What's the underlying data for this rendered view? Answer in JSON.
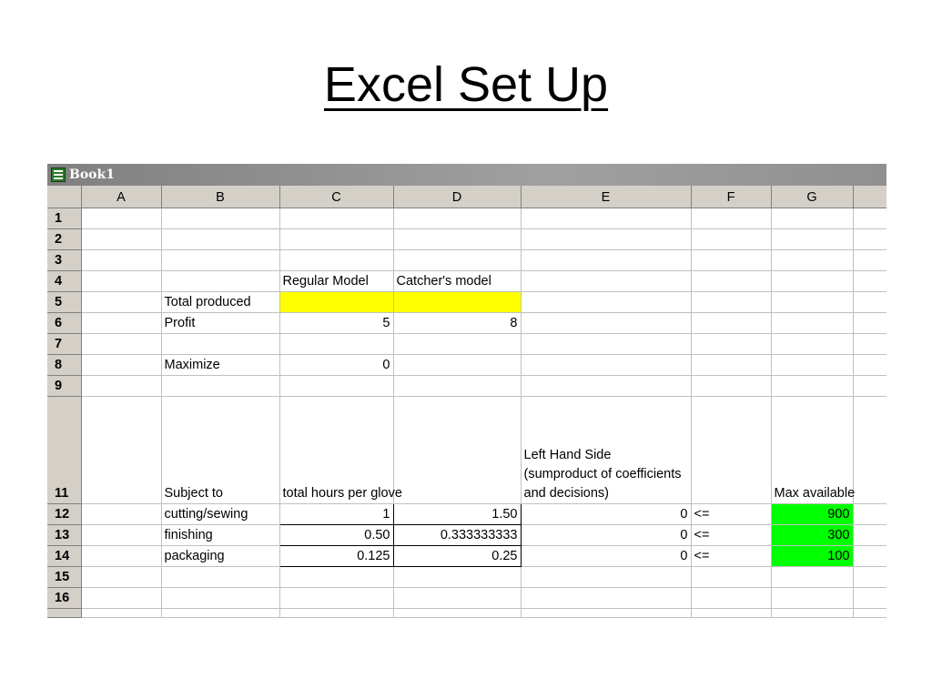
{
  "slide": {
    "title": "Excel Set Up"
  },
  "window": {
    "title": "Book1",
    "icon": "excel-icon"
  },
  "columns": [
    "",
    "A",
    "B",
    "C",
    "D",
    "E",
    "F",
    "G",
    ""
  ],
  "row_numbers": [
    "1",
    "2",
    "3",
    "4",
    "5",
    "6",
    "7",
    "8",
    "9",
    "11",
    "12",
    "13",
    "14",
    "15",
    "16"
  ],
  "cells": {
    "C4": "Regular Model",
    "D4": "Catcher's model",
    "B5": "Total produced",
    "B6": "Profit",
    "C6": "5",
    "D6": "8",
    "B8": "Maximize",
    "C8": "0",
    "E11": "Left Hand Side (sumproduct of coefficients and decisions)",
    "B11": "Subject to",
    "C11": "total hours per glove",
    "G11": "Max available",
    "B12": "cutting/sewing",
    "C12": "1",
    "D12": "1.50",
    "E12": "0",
    "F12": "<=",
    "G12": "900",
    "B13": "finishing",
    "C13": "0.50",
    "D13": "0.333333333",
    "E13": "0",
    "F13": "<=",
    "G13": "300",
    "B14": "packaging",
    "C14": "0.125",
    "D14": "0.25",
    "E14": "0",
    "F14": "<=",
    "G14": "100"
  },
  "colors": {
    "highlight_yellow": "#ffff00",
    "highlight_green": "#00ff00",
    "header_gray": "#d4d0c8"
  }
}
